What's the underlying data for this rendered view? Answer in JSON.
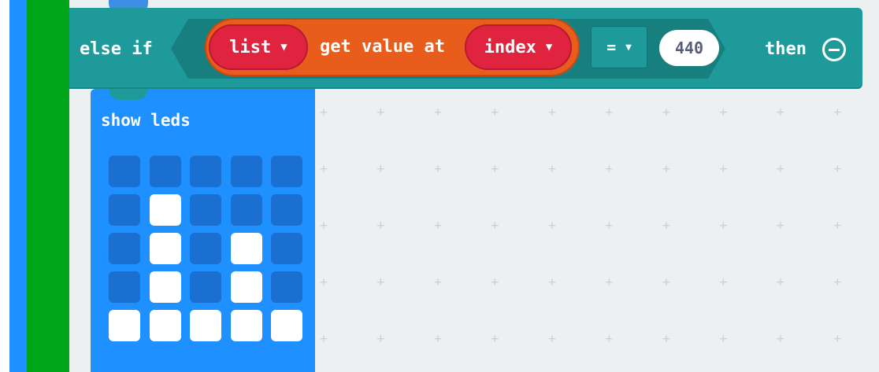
{
  "else_if_block": {
    "keyword_else_if": "else if",
    "list_dropdown": "list",
    "get_value_label": "get value at",
    "index_dropdown": "index",
    "operator_dropdown": "=",
    "compare_value": "440",
    "keyword_then": "then",
    "remove_icon": "remove-circle-icon",
    "color": "#1e9a9a"
  },
  "show_leds_block": {
    "label": "show leds",
    "color": "#1e90ff",
    "leds": [
      [
        0,
        0,
        0,
        0,
        0
      ],
      [
        0,
        1,
        0,
        0,
        0
      ],
      [
        0,
        1,
        0,
        1,
        0
      ],
      [
        0,
        1,
        0,
        1,
        0
      ],
      [
        1,
        1,
        1,
        1,
        1
      ]
    ]
  },
  "colors": {
    "array_block": "#e85c1c",
    "variable_pill": "#e0233f",
    "workspace": "#ecf0f1",
    "basic_blue": "#1e90ff",
    "loop_green": "#00a61a"
  }
}
